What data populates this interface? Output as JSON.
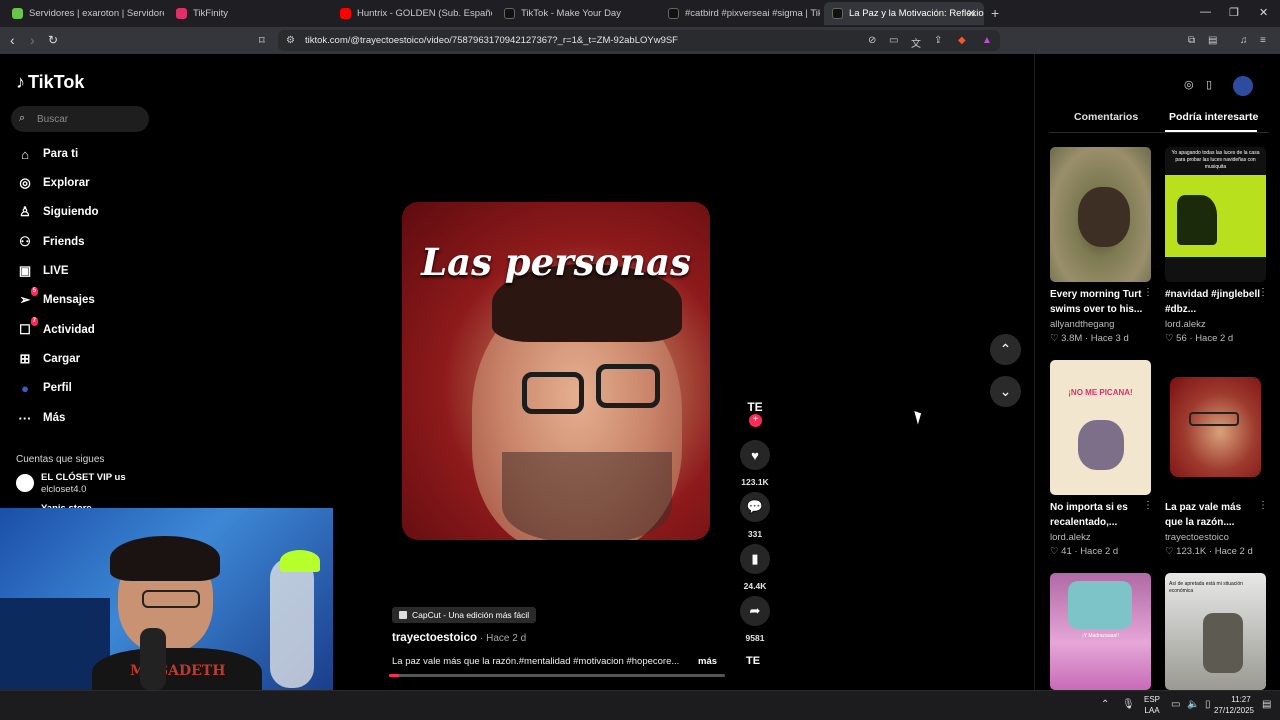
{
  "browser": {
    "tabs": [
      {
        "title": "Servidores | exaroton | Servidores de",
        "favicon_color": "#6ac34b"
      },
      {
        "title": "TikFinity",
        "favicon_color": "#e0306a"
      },
      {
        "title": "Huntrix - GOLDEN (Sub. Español + Ly",
        "favicon_color": "#ff0000"
      },
      {
        "title": "TikTok - Make Your Day",
        "favicon_color": "#111111"
      },
      {
        "title": "#catbird #pixverseai #sigma | TikTok",
        "favicon_color": "#111111"
      },
      {
        "title": "La Paz y la Motivación: Reflexion",
        "favicon_color": "#111111"
      }
    ],
    "url": "tiktok.com/@trayectoestoico/video/7587963170942127367?_r=1&_t=ZM-92abLOYw9SF",
    "new_tab_symbol": "+"
  },
  "sidebar": {
    "logo": "TikTok",
    "search_placeholder": "Buscar",
    "items": [
      {
        "label": "Para ti",
        "icon": "home-icon",
        "glyph": "⌂"
      },
      {
        "label": "Explorar",
        "icon": "compass-icon",
        "glyph": "◎"
      },
      {
        "label": "Siguiendo",
        "icon": "following-icon",
        "glyph": "♙"
      },
      {
        "label": "Friends",
        "icon": "friends-icon",
        "glyph": "⚇"
      },
      {
        "label": "LIVE",
        "icon": "live-icon",
        "glyph": "▣"
      },
      {
        "label": "Mensajes",
        "icon": "messages-icon",
        "glyph": "➢",
        "badge": "5"
      },
      {
        "label": "Actividad",
        "icon": "activity-icon",
        "glyph": "☐",
        "badge": "7"
      },
      {
        "label": "Cargar",
        "icon": "upload-icon",
        "glyph": "⊞"
      },
      {
        "label": "Perfil",
        "icon": "profile-icon",
        "glyph": "●"
      },
      {
        "label": "Más",
        "icon": "more-icon",
        "glyph": "···"
      }
    ],
    "following_title": "Cuentas que sigues",
    "accounts": [
      {
        "name": "EL CLÓSET VIP us",
        "handle": "elcloset4.0"
      },
      {
        "name": "Yanis store"
      }
    ]
  },
  "video": {
    "caption_overlay": "Las personas",
    "capcut_label": "CapCut - Una edición más fácil",
    "author": "trayectoestoico",
    "date": "· Hace 2 d",
    "description": "La paz vale más que la razón.#mentalidad #motivacion #hopecore...",
    "more_label": "más",
    "author_initials": "TE",
    "progress": 0.03,
    "stats": {
      "likes": "123.1K",
      "comments": "331",
      "saves": "24.4K",
      "shares": "9581"
    }
  },
  "right_panel": {
    "tabs": [
      "Comentarios",
      "Podría interesarte"
    ],
    "active_tab": "Podría interesarte",
    "cards": [
      {
        "title": "Every morning Turt swims over to his...",
        "user": "allyandthegang",
        "likes": "3.8M",
        "date": "Hace 3 d",
        "thumb_text": ""
      },
      {
        "title": "#navidad #jinglebell #dbz...",
        "user": "lord.alekz",
        "likes": "56",
        "date": "Hace 2 d",
        "thumb_text": "Yo apagando todas las luces de la casa para probar las luces navideñas con musiquita"
      },
      {
        "title": "No importa si es recalentado,...",
        "user": "lord.alekz",
        "likes": "41",
        "date": "Hace 2 d",
        "thumb_text": "¡NO ME PICANA!"
      },
      {
        "title": "La paz vale más que la razón....",
        "user": "trayectoestoico",
        "likes": "123.1K",
        "date": "Hace 2 d",
        "thumb_text": ""
      },
      {
        "title": "",
        "user": "",
        "likes": "",
        "date": "",
        "thumb_text": "¡Y Madrazaaaa!!"
      },
      {
        "title": "",
        "user": "",
        "likes": "",
        "date": "",
        "thumb_text": "Así de apretada está mi situación económica"
      }
    ]
  },
  "taskbar": {
    "lang": "ESP",
    "region": "LAA",
    "time": "11:27",
    "date": "27/12/2025"
  },
  "colors": {
    "accent": "#fe2c55",
    "background": "#000000"
  }
}
